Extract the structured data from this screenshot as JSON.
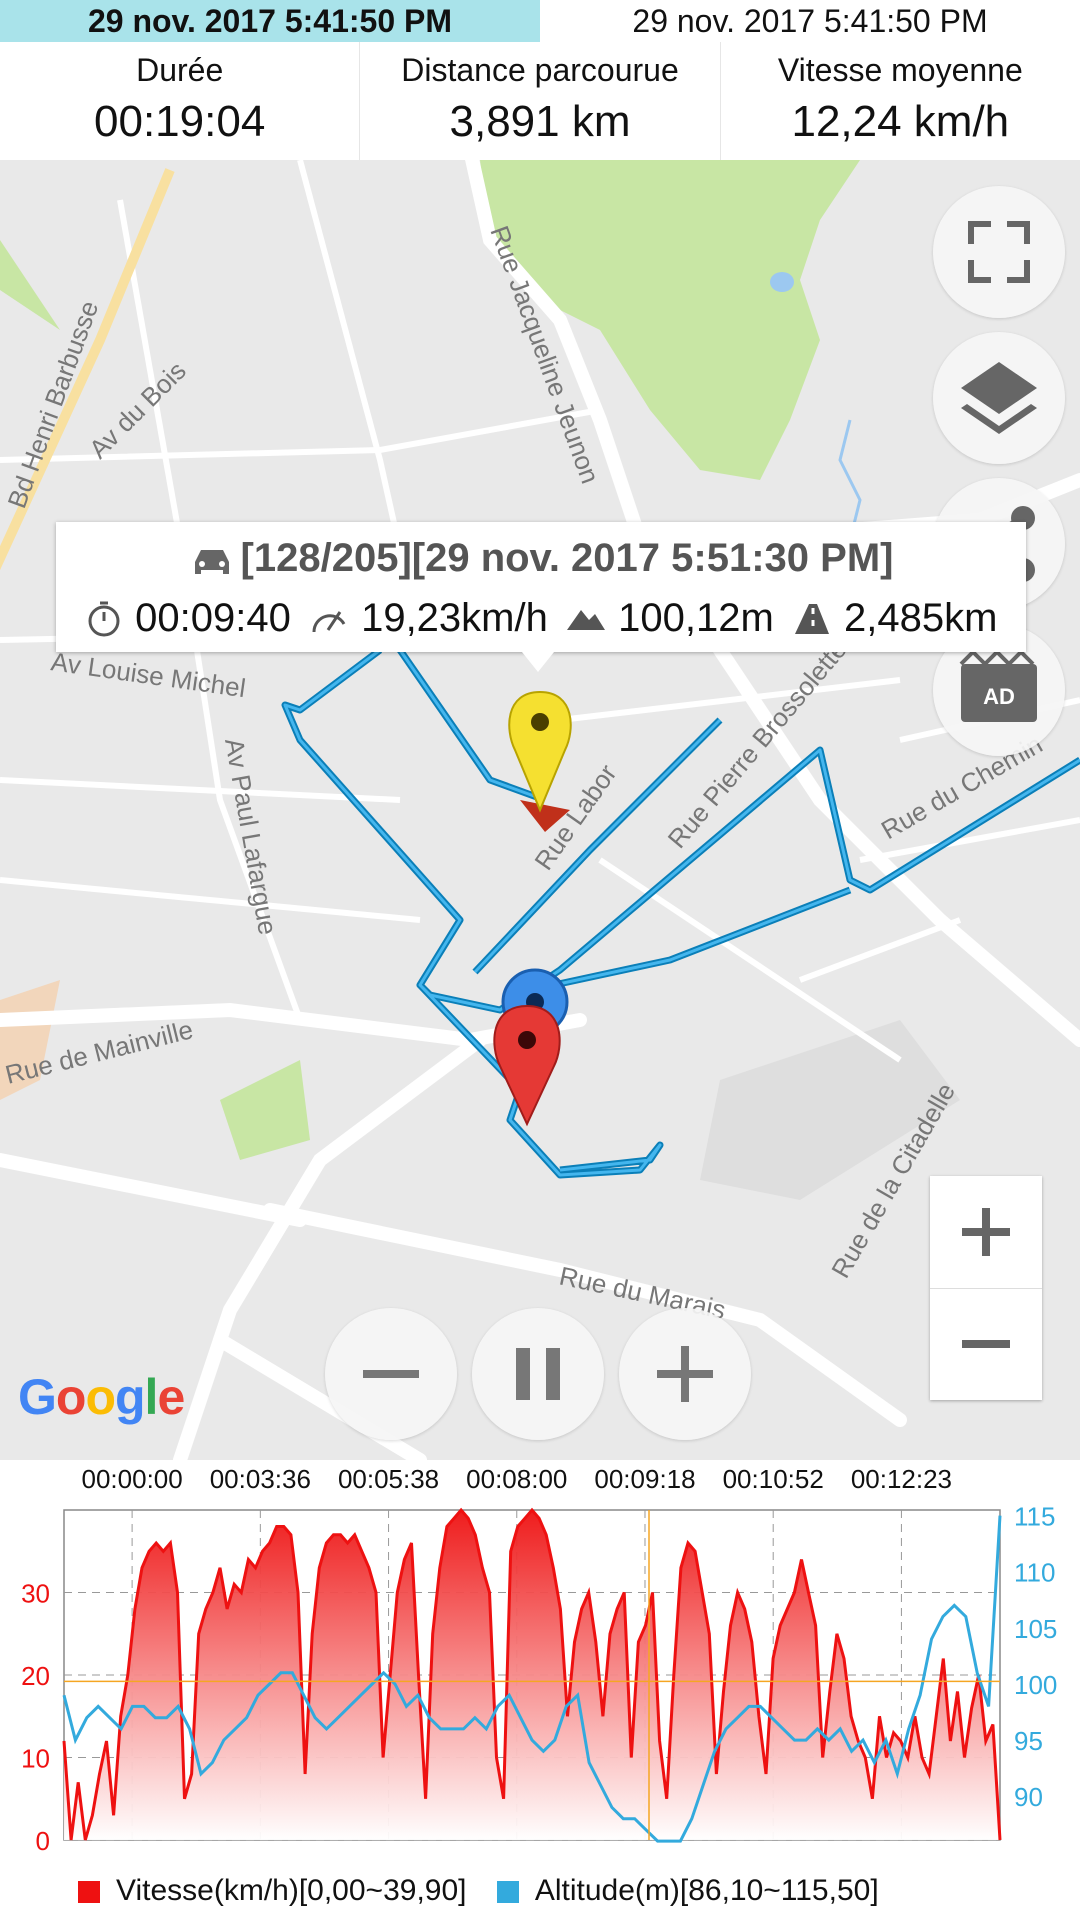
{
  "header": {
    "time_left": "29 nov. 2017 5:41:50 PM",
    "time_right": "29 nov. 2017 5:41:50 PM"
  },
  "stats": [
    {
      "label": "Durée",
      "value": "00:19:04"
    },
    {
      "label": "Distance parcourue",
      "value": "3,891 km"
    },
    {
      "label": "Vitesse moyenne",
      "value": "12,24 km/h"
    }
  ],
  "map": {
    "streets": [
      "Bd Henri Barbusse",
      "Av du Bois",
      "Rue Jacqueline Jeunon",
      "Av Louise Michel",
      "Av Paul Lafargue",
      "Rue Labor",
      "Rue Pierre Brossolette",
      "Rue du Chemin",
      "Rue de Mainville",
      "Rue de la Citadelle",
      "Rue du Marais"
    ],
    "tooltip": {
      "title": "[128/205][29 nov. 2017 5:51:30 PM]",
      "time": "00:09:40",
      "speed": "19,23km/h",
      "altitude": "100,12m",
      "distance": "2,485km"
    },
    "google_logo": "Google",
    "ad_label": "AD",
    "icons": [
      "fullscreen-icon",
      "layers-icon",
      "share-icon",
      "ad-icon",
      "zoom-in-icon",
      "zoom-out-icon",
      "slower-icon",
      "pause-icon",
      "faster-icon"
    ]
  },
  "chart_data": {
    "type": "line",
    "x_ticks": [
      "00:00:00",
      "00:03:36",
      "00:05:38",
      "00:08:00",
      "00:09:18",
      "00:10:52",
      "00:12:23"
    ],
    "y_left_ticks": [
      "0",
      "10",
      "20",
      "30"
    ],
    "y_right_ticks": [
      "90",
      "95",
      "100",
      "105",
      "110",
      "115"
    ],
    "y_left_range": [
      0,
      40
    ],
    "y_right_range": [
      86.1,
      115.5
    ],
    "series": [
      {
        "name": "Vitesse(km/h)[0,00~39,90]",
        "color": "#ee1111",
        "axis": "left",
        "values": [
          12,
          0,
          7,
          0,
          3,
          8,
          12,
          3,
          15,
          20,
          28,
          33,
          35,
          36,
          35,
          36,
          30,
          5,
          8,
          25,
          28,
          30,
          33,
          28,
          31,
          30,
          34,
          33,
          35,
          36,
          38,
          38,
          37,
          30,
          8,
          25,
          33,
          36,
          37,
          37,
          36,
          37,
          35,
          33,
          30,
          10,
          20,
          30,
          34,
          36,
          20,
          5,
          25,
          33,
          38,
          39,
          40,
          39,
          37,
          33,
          30,
          10,
          5,
          35,
          38,
          39,
          40,
          39,
          37,
          33,
          28,
          15,
          24,
          28,
          30,
          24,
          15,
          25,
          28,
          30,
          10,
          24,
          26,
          30,
          12,
          5,
          20,
          33,
          36,
          35,
          30,
          25,
          8,
          18,
          26,
          30,
          28,
          24,
          15,
          8,
          22,
          26,
          28,
          30,
          34,
          30,
          26,
          10,
          18,
          25,
          22,
          15,
          12,
          10,
          5,
          15,
          10,
          13,
          12,
          10,
          15,
          10,
          8,
          15,
          22,
          12,
          18,
          10,
          16,
          20,
          12,
          14,
          0
        ]
      },
      {
        "name": "Altitude(m)[86,10~115,50]",
        "color": "#33aadd",
        "axis": "right",
        "values": [
          99,
          95,
          97,
          98,
          97,
          96,
          98,
          98,
          97,
          97,
          98,
          96,
          92,
          93,
          95,
          96,
          97,
          99,
          100,
          101,
          101,
          99,
          97,
          96,
          97,
          98,
          99,
          100,
          101,
          100,
          98,
          99,
          97,
          96,
          96,
          96,
          97,
          96,
          98,
          99,
          97,
          95,
          94,
          95,
          98,
          99,
          93,
          91,
          89,
          88,
          88,
          87,
          86,
          86,
          86,
          88,
          91,
          94,
          96,
          97,
          98,
          98,
          97,
          96,
          95,
          95,
          96,
          95,
          96,
          94,
          95,
          93,
          95,
          92,
          96,
          99,
          104,
          106,
          107,
          106,
          101,
          98,
          115
        ]
      }
    ],
    "marker_x_fraction": 0.625,
    "marker_y_value": 19.23
  },
  "legend": {
    "speed": "Vitesse(km/h)[0,00~39,90]",
    "altitude": "Altitude(m)[86,10~115,50]",
    "speed_color": "#ee1111",
    "altitude_color": "#33aadd"
  }
}
